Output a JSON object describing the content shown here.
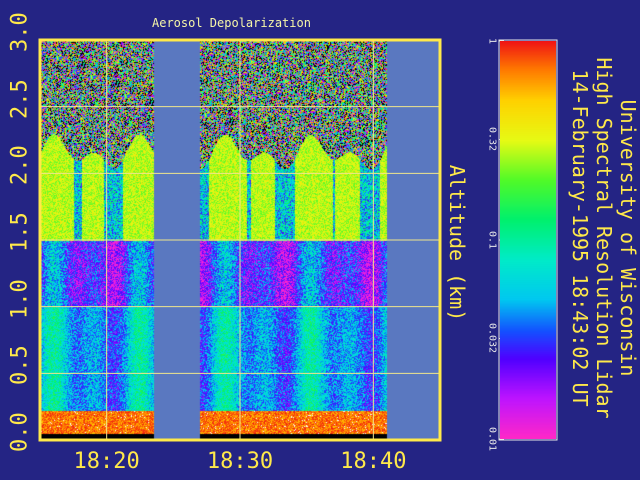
{
  "chart_data": {
    "type": "heatmap",
    "title": "Aerosol Depolarization",
    "ylabel": "Altitude (km)",
    "xlabel": "",
    "x_ticks": [
      "18:20",
      "18:30",
      "18:40"
    ],
    "y_ticks": [
      "0.0",
      "0.5",
      "1.0",
      "1.5",
      "2.0",
      "2.5",
      "3.0"
    ],
    "ylim": [
      0.0,
      3.0
    ],
    "grid": true,
    "colorbar": {
      "scale": "log",
      "range": [
        0.01,
        1
      ],
      "tick_labels": [
        "1",
        "0.32",
        "0.1",
        "0.032",
        "0.01"
      ]
    },
    "data_gaps_minutes_after_1815": [
      [
        8.5,
        12.0
      ],
      [
        26.0,
        30.5
      ]
    ],
    "cloud_layer_altitudes_km": [
      [
        1.5,
        2.0
      ]
    ],
    "depolarization_by_altitude_km": {
      "below_0.1": 0.9,
      "0.1_to_1.0": 0.05,
      "1.0_to_1.5": 0.02,
      "1.5_to_2.0": 0.4,
      "above_2.0": "noise"
    }
  },
  "info": {
    "line1": "University of Wisconsin",
    "line2": "High Spectral Resolution Lidar",
    "line3": "14-February-1995 18:43:02 UT"
  },
  "colors": {
    "background": "#242484",
    "frame": "#ffe94a",
    "gap": "#5a78c0",
    "text": "#ffe94a"
  }
}
